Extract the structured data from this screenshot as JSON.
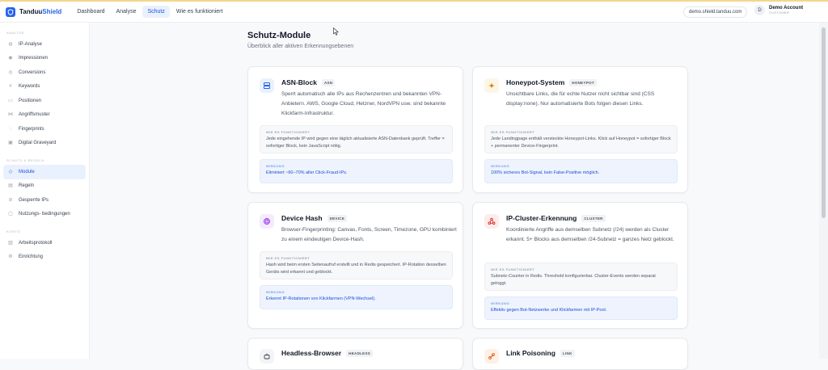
{
  "brand": {
    "name_part1": "Tanduu",
    "name_part2": "Shield"
  },
  "nav": [
    {
      "label": "Dashboard"
    },
    {
      "label": "Analyse"
    },
    {
      "label": "Schutz"
    },
    {
      "label": "Wie es funktioniert"
    }
  ],
  "header": {
    "domain": "demo.shield.tanduu.com",
    "account_name": "Demo Account",
    "account_role": "CUSTOMER",
    "avatar_initial": "D"
  },
  "sidebar": {
    "sections": [
      {
        "title": "ANALYSE",
        "items": [
          {
            "label": "IP-Analyse",
            "icon": "ip-icon"
          },
          {
            "label": "Impressionen",
            "icon": "eye-icon"
          },
          {
            "label": "Conversions",
            "icon": "conversion-icon"
          },
          {
            "label": "Keywords",
            "icon": "hash-icon"
          },
          {
            "label": "Positionen",
            "icon": "position-icon"
          },
          {
            "label": "Angriffsmuster",
            "icon": "pattern-icon"
          },
          {
            "label": "Fingerprints",
            "icon": "fingerprint-icon"
          },
          {
            "label": "Digital Graveyard",
            "icon": "graveyard-icon"
          }
        ]
      },
      {
        "title": "SCHUTZ & REGELN",
        "items": [
          {
            "label": "Module",
            "icon": "shield-icon"
          },
          {
            "label": "Regeln",
            "icon": "rules-icon"
          },
          {
            "label": "Gesperrte IPs",
            "icon": "block-icon"
          },
          {
            "label": "Nutzungs- bedingungen",
            "icon": "terms-icon"
          }
        ]
      },
      {
        "title": "KONTO",
        "items": [
          {
            "label": "Arbeitsprotokoll",
            "icon": "log-icon"
          },
          {
            "label": "Einrichtung",
            "icon": "settings-icon"
          }
        ]
      }
    ]
  },
  "main": {
    "title": "Schutz-Module",
    "subtitle": "Überblick aller aktiven Erkennungsebenen"
  },
  "modules": [
    {
      "title": "ASN-Block",
      "badge": "ASN",
      "icon": "server-icon",
      "icon_color": "#2563eb",
      "icon_bg": "#eaf1fe",
      "desc": "Sperrt automatisch alle IPs aus Rechenzentren und bekannten VPN-Anbietern. AWS, Google Cloud, Hetzner, NordVPN usw. sind bekannte Klickfarm-Infrastruktur.",
      "how_label": "WIE ES FUNKTIONIERT",
      "how": "Jede eingehende IP wird gegen eine täglich aktualisierte ASN-Datenbank geprüft. Treffer = sofortiger Block, kein JavaScript nötig.",
      "effect_label": "WIRKUNG",
      "effect": "Eliminiert ~60–70% aller Click-Fraud-IPs."
    },
    {
      "title": "Honeypot-System",
      "badge": "HONEYPOT",
      "icon": "honeypot-icon",
      "icon_color": "#d97706",
      "icon_bg": "#fdf5e6",
      "desc": "Unsichtbare Links, die für echte Nutzer nicht sichtbar sind (CSS display:none). Nur automatisierte Bots folgen diesen Links.",
      "how_label": "WIE ES FUNKTIONIERT",
      "how": "Jede Landingpage enthält versteckte Honeypot-Links. Klick auf Honeypot = sofortiger Block + permanenter Device-Fingerprint.",
      "effect_label": "WIRKUNG",
      "effect": "100% sicheres Bot-Signal, kein False-Positive möglich."
    },
    {
      "title": "Device Hash",
      "badge": "DEVICE",
      "icon": "fingerprint-icon",
      "icon_color": "#9333ea",
      "icon_bg": "#f5ebfd",
      "desc": "Browser-Fingerprinting: Canvas, Fonts, Screen, Timezone, GPU kombiniert zu einem eindeutigen Device-Hash.",
      "how_label": "WIE ES FUNKTIONIERT",
      "how": "Hash wird beim ersten Seitenaufruf erstellt und in Redis gespeichert. IP-Rotation desselben Geräts wird erkannt und geblockt.",
      "effect_label": "WIRKUNG",
      "effect": "Erkennt IP-Rotationen von Klickfarmen (VPN-Wechsel)."
    },
    {
      "title": "IP-Cluster-Erkennung",
      "badge": "CLUSTER",
      "icon": "cluster-icon",
      "icon_color": "#dc2626",
      "icon_bg": "#fdecec",
      "desc": "Koordinierte Angriffe aus demselben Subnetz (/24) werden als Cluster erkannt. 5+ Blocks aus demselben /24-Subnetz = ganzes Netz geblockt.",
      "how_label": "WIE ES FUNKTIONIERT",
      "how": "Subnetz-Counter in Redis. Threshold konfigurierbar. Cluster-Events werden separat geloggt.",
      "effect_label": "WIRKUNG",
      "effect": "Effektiv gegen Bot-Netzwerke und Klickfarmen mit IP-Pool."
    },
    {
      "title": "Headless-Browser",
      "badge": "HEADLESS",
      "icon": "robot-icon",
      "icon_color": "#374151",
      "icon_bg": "#f3f4f6"
    },
    {
      "title": "Link Poisoning",
      "badge": "LINK",
      "icon": "link-poison-icon",
      "icon_color": "#ea580c",
      "icon_bg": "#fdf0e6"
    }
  ]
}
